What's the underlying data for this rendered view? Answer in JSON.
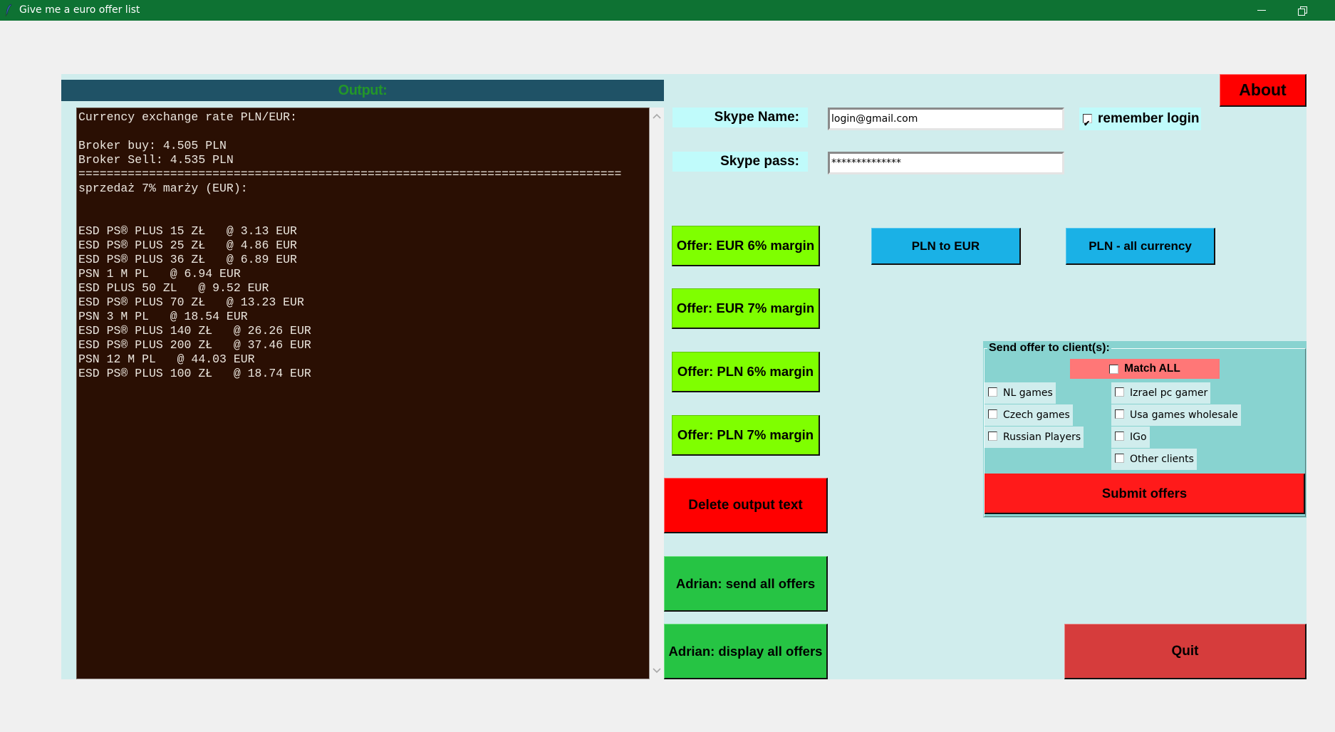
{
  "window": {
    "title": "Give me a euro offer list",
    "app_icon": "feather-icon",
    "controls": {
      "minimize": "minimize-icon",
      "restore": "restore-icon"
    }
  },
  "output": {
    "header": "Output:",
    "lines": [
      "Currency exchange rate PLN/EUR:",
      "",
      "Broker buy: 4.505 PLN",
      "Broker Sell: 4.535 PLN",
      "=============================================================================",
      "sprzedaż 7% marży (EUR):",
      "",
      "",
      "ESD PS® PLUS 15 ZŁ   @ 3.13 EUR",
      "ESD PS® PLUS 25 ZŁ   @ 4.86 EUR",
      "ESD PS® PLUS 36 ZŁ   @ 6.89 EUR",
      "PSN 1 M PL   @ 6.94 EUR",
      "ESD PLUS 50 ZL   @ 9.52 EUR",
      "ESD PS® PLUS 70 ZŁ   @ 13.23 EUR",
      "PSN 3 M PL   @ 18.54 EUR",
      "ESD PS® PLUS 140 ZŁ   @ 26.26 EUR",
      "ESD PS® PLUS 200 ZŁ   @ 37.46 EUR",
      "PSN 12 M PL   @ 44.03 EUR",
      "ESD PS® PLUS 100 ZŁ   @ 18.74 EUR"
    ],
    "scroll_up": "^",
    "scroll_down": "v"
  },
  "login": {
    "name_label": "Skype Name:",
    "name_value": "login@gmail.com",
    "pass_label": "Skype pass:",
    "pass_value": "**************",
    "remember_label": "remember login",
    "remember_checked": true
  },
  "buttons": {
    "about": "About",
    "offer_eur_6": "Offer: EUR 6% margin",
    "offer_eur_7": "Offer: EUR 7% margin",
    "offer_pln_6": "Offer: PLN 6% margin",
    "offer_pln_7": "Offer: PLN 7% margin",
    "pln_to_eur": "PLN to EUR",
    "pln_all_currency": "PLN - all currency",
    "delete_output": "Delete output text",
    "adrian_send": "Adrian: send all offers",
    "adrian_display": "Adrian: display all offers",
    "quit": "Quit"
  },
  "clients": {
    "title": "Send offer to client(s):",
    "match_all": {
      "label": "Match ALL",
      "checked": false
    },
    "left": [
      {
        "label": "NL games",
        "checked": false
      },
      {
        "label": "Czech games",
        "checked": false
      },
      {
        "label": "Russian Players",
        "checked": false
      }
    ],
    "right": [
      {
        "label": "Izrael pc gamer",
        "checked": false
      },
      {
        "label": "Usa games wholesale",
        "checked": false
      },
      {
        "label": "IGo",
        "checked": false
      },
      {
        "label": "Other clients",
        "checked": false
      }
    ],
    "submit": "Submit offers"
  },
  "colors": {
    "titlebar": "#0e7233",
    "panel_bg": "#d0eded",
    "output_header_bg": "#1f5266",
    "output_header_text": "#23962a",
    "output_bg": "#2a0f03",
    "offer_button": "#7fff00",
    "convert_button": "#1ab1e6",
    "danger_button": "#ff0000",
    "adrian_button": "#26c444",
    "quit_button": "#d63c3c",
    "match_all_bg": "#ff7777",
    "clients_frame_bg": "#88d3d0"
  }
}
